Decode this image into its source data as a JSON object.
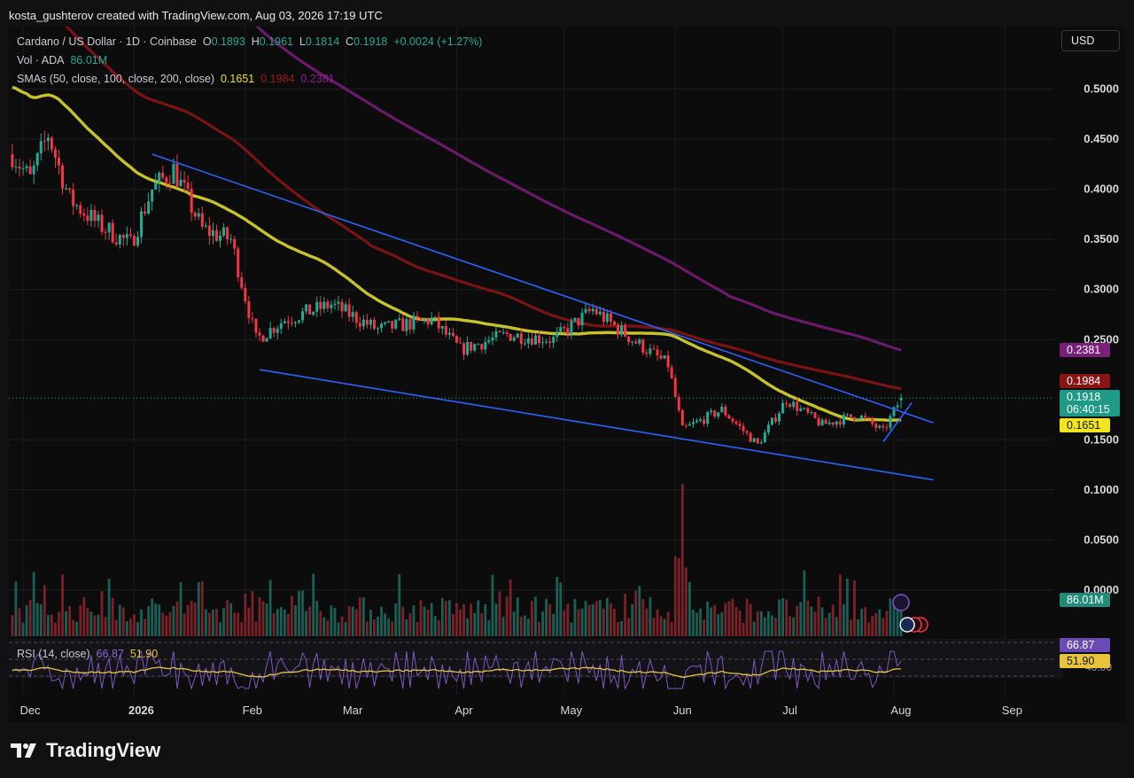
{
  "header": {
    "text": "kosta_gushterov created with TradingView.com, Aug 03, 2026 17:19 UTC"
  },
  "legend": {
    "symbol": "Cardano / US Dollar · 1D · Coinbase",
    "o_label": "O",
    "o": "0.1893",
    "h_label": "H",
    "h": "0.1961",
    "l_label": "L",
    "l": "0.1814",
    "c_label": "C",
    "c": "0.1918",
    "change": "+0.0024 (+1.27%)",
    "vol_label": "Vol · ADA",
    "vol": "86.01M",
    "sma_label": "SMAs (50, close, 100, close, 200, close)",
    "sma50": "0.1651",
    "sma100": "0.1984",
    "sma200": "0.2381"
  },
  "currency_button": "USD",
  "price_tags": {
    "sma200": "0.2381",
    "sma100": "0.1984",
    "last": "0.1918",
    "countdown": "06:40:15",
    "sma50": "0.1651",
    "volume": "86.01M"
  },
  "rsi": {
    "label": "RSI (14, close)",
    "value": "66.87",
    "ma": "51.90",
    "tick_label": "40.00"
  },
  "branding": {
    "logo_text": "TradingView"
  },
  "colors": {
    "up": "#22ab94",
    "down": "#f23645",
    "sma50": "#c7c12a",
    "sma100": "#7a1414",
    "sma200": "#6b1a6b",
    "trendline": "#2962ff",
    "rsi": "#7e57c2",
    "rsi_ma": "#e8c43a"
  },
  "chart_data": {
    "type": "candlestick",
    "title": "Cardano / US Dollar · 1D · Coinbase",
    "ylim": [
      0.0,
      0.55
    ],
    "y_ticks": [
      "0.5000",
      "0.4500",
      "0.4000",
      "0.3500",
      "0.3000",
      "0.2500",
      "0.1500",
      "0.1000",
      "0.0500",
      "0.0000"
    ],
    "x_ticks": [
      "Dec",
      "2026",
      "Feb",
      "Mar",
      "Apr",
      "May",
      "Jun",
      "Jul",
      "Aug",
      "Sep"
    ],
    "approx_close_path": [
      {
        "x": "Nov 28",
        "y": 0.435
      },
      {
        "x": "Dec 3",
        "y": 0.41
      },
      {
        "x": "Dec 8",
        "y": 0.455
      },
      {
        "x": "Dec 14",
        "y": 0.39
      },
      {
        "x": "Dec 22",
        "y": 0.365
      },
      {
        "x": "Dec 31",
        "y": 0.345
      },
      {
        "x": "Jan 6",
        "y": 0.4
      },
      {
        "x": "Jan 12",
        "y": 0.42
      },
      {
        "x": "Jan 20",
        "y": 0.36
      },
      {
        "x": "Jan 28",
        "y": 0.35
      },
      {
        "x": "Feb 4",
        "y": 0.25
      },
      {
        "x": "Feb 12",
        "y": 0.27
      },
      {
        "x": "Feb 25",
        "y": 0.285
      },
      {
        "x": "Mar 10",
        "y": 0.26
      },
      {
        "x": "Mar 25",
        "y": 0.27
      },
      {
        "x": "Apr 2",
        "y": 0.24
      },
      {
        "x": "Apr 15",
        "y": 0.255
      },
      {
        "x": "Apr 28",
        "y": 0.25
      },
      {
        "x": "May 9",
        "y": 0.28
      },
      {
        "x": "May 20",
        "y": 0.25
      },
      {
        "x": "May 30",
        "y": 0.225
      },
      {
        "x": "Jun 3",
        "y": 0.16
      },
      {
        "x": "Jun 14",
        "y": 0.18
      },
      {
        "x": "Jun 24",
        "y": 0.145
      },
      {
        "x": "Jul 2",
        "y": 0.19
      },
      {
        "x": "Jul 12",
        "y": 0.165
      },
      {
        "x": "Jul 22",
        "y": 0.175
      },
      {
        "x": "Jul 29",
        "y": 0.158
      },
      {
        "x": "Aug 3",
        "y": 0.1918
      }
    ],
    "series": [
      {
        "name": "SMA 50",
        "last": 0.1651
      },
      {
        "name": "SMA 100",
        "last": 0.1984
      },
      {
        "name": "SMA 200",
        "last": 0.2381
      }
    ],
    "last": {
      "open": 0.1893,
      "high": 0.1961,
      "low": 0.1814,
      "close": 0.1918,
      "volume": "86.01M"
    },
    "volume_spike": {
      "x": "Jun 3"
    }
  }
}
